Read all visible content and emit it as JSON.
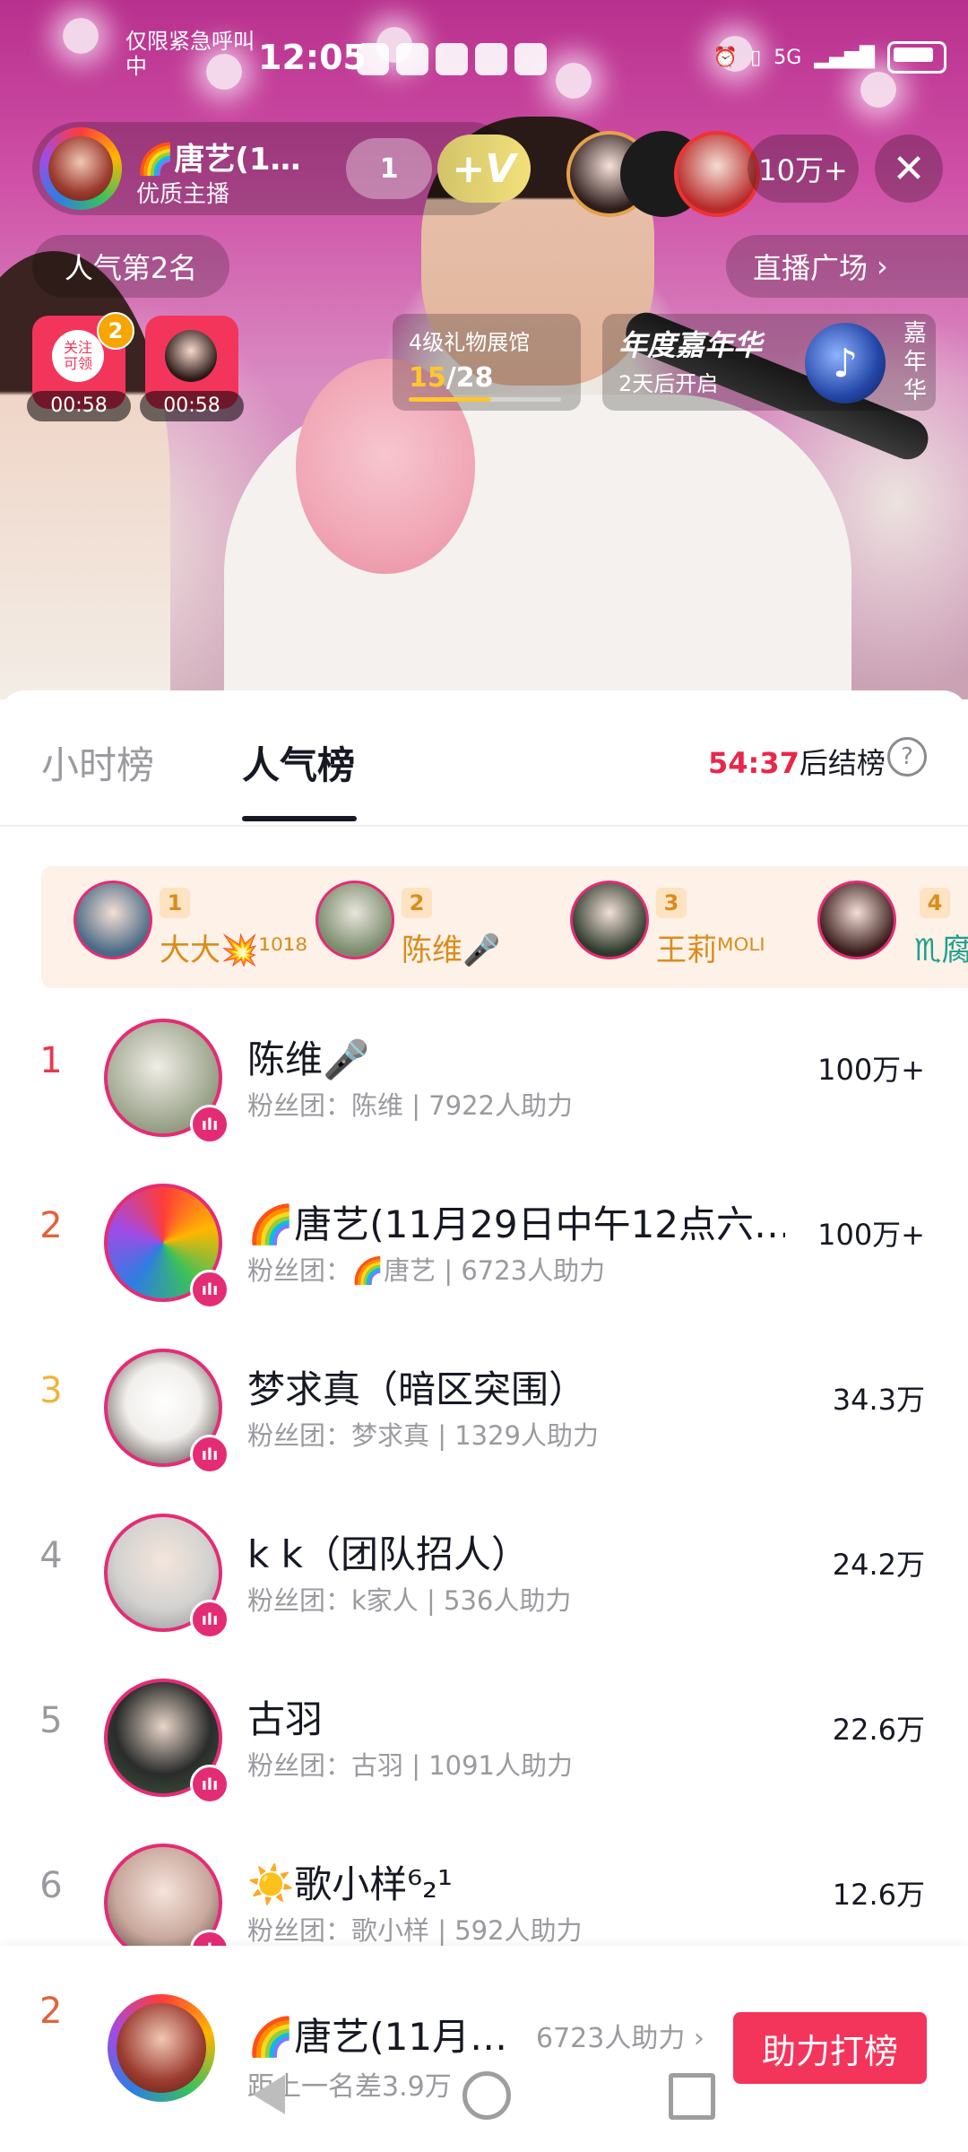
{
  "status_bar": {
    "emergency": "仅限紧急呼叫中",
    "time": "12:05",
    "network": "5G"
  },
  "live": {
    "host_name": "🌈唐艺(1…",
    "host_subtitle": "优质主播",
    "like_count": "1",
    "v_badge": "+V",
    "viewer_count": "10万+",
    "close_icon": "close-icon",
    "rank_label": "人气第2名",
    "plaza_label": "直播广场",
    "red_cards": [
      {
        "label": "关注\n可领",
        "badge": "2",
        "time": "00:58"
      },
      {
        "label": "",
        "badge": "",
        "time": "00:58"
      }
    ],
    "gift_hall": {
      "title": "4级礼物展馆",
      "current": "15",
      "total": "/28",
      "progress_fraction": 0.54
    },
    "carnival": {
      "title": "年度嘉年华",
      "subtitle": "2天后开启",
      "vertical": "嘉年华"
    }
  },
  "sheet": {
    "tabs": [
      {
        "label": "小时榜"
      },
      {
        "label": "人气榜"
      }
    ],
    "active_tab": "人气榜",
    "countdown_time": "54:37",
    "countdown_suffix": "后结榜",
    "help_icon": "?"
  },
  "top_strip": [
    {
      "rank": "1",
      "name": "大大💥¹⁰¹⁸"
    },
    {
      "rank": "2",
      "name": "陈维🎤"
    },
    {
      "rank": "3",
      "name": "王莉ᴹᴼᴸᴵ"
    },
    {
      "rank": "4",
      "name": "♏腐"
    }
  ],
  "rankings": [
    {
      "rank": "1",
      "name": "陈维🎤",
      "sub": "粉丝团：陈维 | 7922人助力",
      "score": "100万+",
      "rank_color": "#e8384f"
    },
    {
      "rank": "2",
      "name": "🌈唐艺(11月29日中午12点六…",
      "sub": "粉丝团：🌈唐艺 | 6723人助力",
      "score": "100万+",
      "rank_color": "#e2623c"
    },
    {
      "rank": "3",
      "name": "梦求真（暗区突围）",
      "sub": "粉丝团：梦求真 | 1329人助力",
      "score": "34.3万",
      "rank_color": "#f0b43c"
    },
    {
      "rank": "4",
      "name": "k k（团队招人）",
      "sub": "粉丝团：k家人 | 536人助力",
      "score": "24.2万",
      "rank_color": "#9a9a9f"
    },
    {
      "rank": "5",
      "name": "古羽",
      "sub": "粉丝团：古羽 | 1091人助力",
      "score": "22.6万",
      "rank_color": "#9a9a9f"
    },
    {
      "rank": "6",
      "name": "☀️歌小样⁶₂¹",
      "sub": "粉丝团：歌小样 | 592人助力",
      "score": "12.6万",
      "rank_color": "#9a9a9f"
    }
  ],
  "bottom_bar": {
    "rank": "2",
    "name": "🌈唐艺(11月…",
    "sub": "距上一名差3.9万",
    "help_count": "6723人助力 ›",
    "button_label": "助力打榜"
  }
}
